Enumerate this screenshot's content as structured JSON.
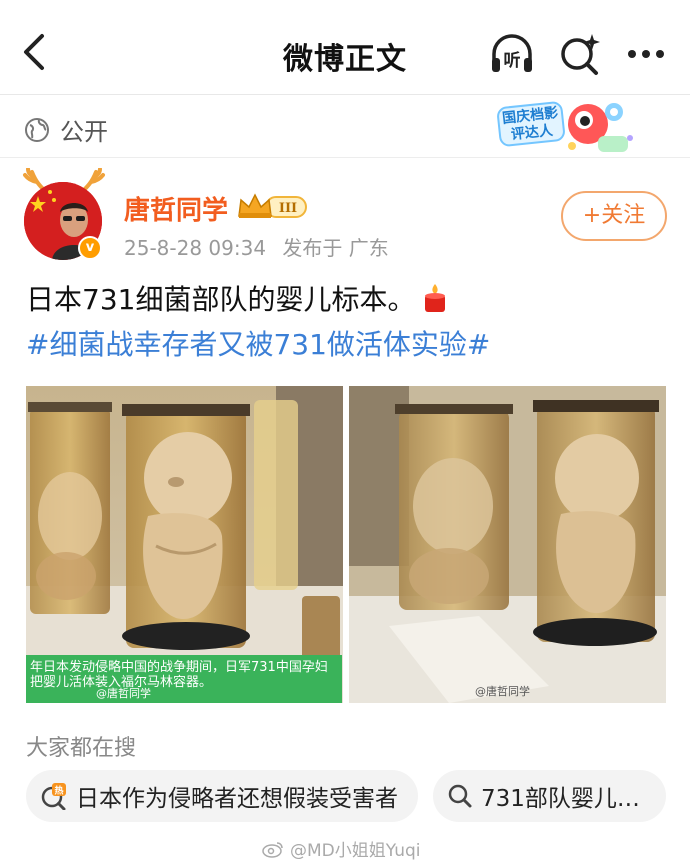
{
  "header": {
    "title": "微博正文",
    "back_icon": "back-chevron-icon",
    "listen_label": "听",
    "listen_icon": "headphones-listen-icon",
    "search_icon": "search-sparkle-icon",
    "more_icon": "more-dots-icon"
  },
  "visibility": {
    "icon": "globe-icon",
    "label": "公开",
    "badge_text": "国庆档影评达人",
    "badge_icon": "mascot-badge-icon"
  },
  "post": {
    "author": "唐哲同学",
    "level_badge": "III",
    "verified_mark": "v",
    "date": "25-8-28 09:34",
    "location": "发布于 广东",
    "follow_label": "+关注",
    "text": "日本731细菌部队的婴儿标本。",
    "text_emoji": "candle-emoji-icon",
    "topic": "#细菌战幸存者又被731做活体实验#"
  },
  "images": [
    {
      "caption": "年日本发动侵略中国的战争期间，日军731中国孕妇把婴儿活体装入福尔马林容器。",
      "handle": "@唐哲同学"
    },
    {
      "watermark": "@唐哲同学"
    }
  ],
  "search": {
    "title": "大家都在搜",
    "chips": [
      {
        "label": "日本作为侵略者还想假装受害者",
        "icon": "hot-search-icon"
      },
      {
        "label": "731部队婴儿…",
        "icon": "search-icon"
      }
    ]
  },
  "footer": {
    "watermark": "@MD小姐姐Yuqi"
  },
  "colors": {
    "username": "#f25d1f",
    "topic": "#3b7fd6",
    "follow_border": "#f3a76d",
    "chip_bg": "#f3f3f3"
  }
}
